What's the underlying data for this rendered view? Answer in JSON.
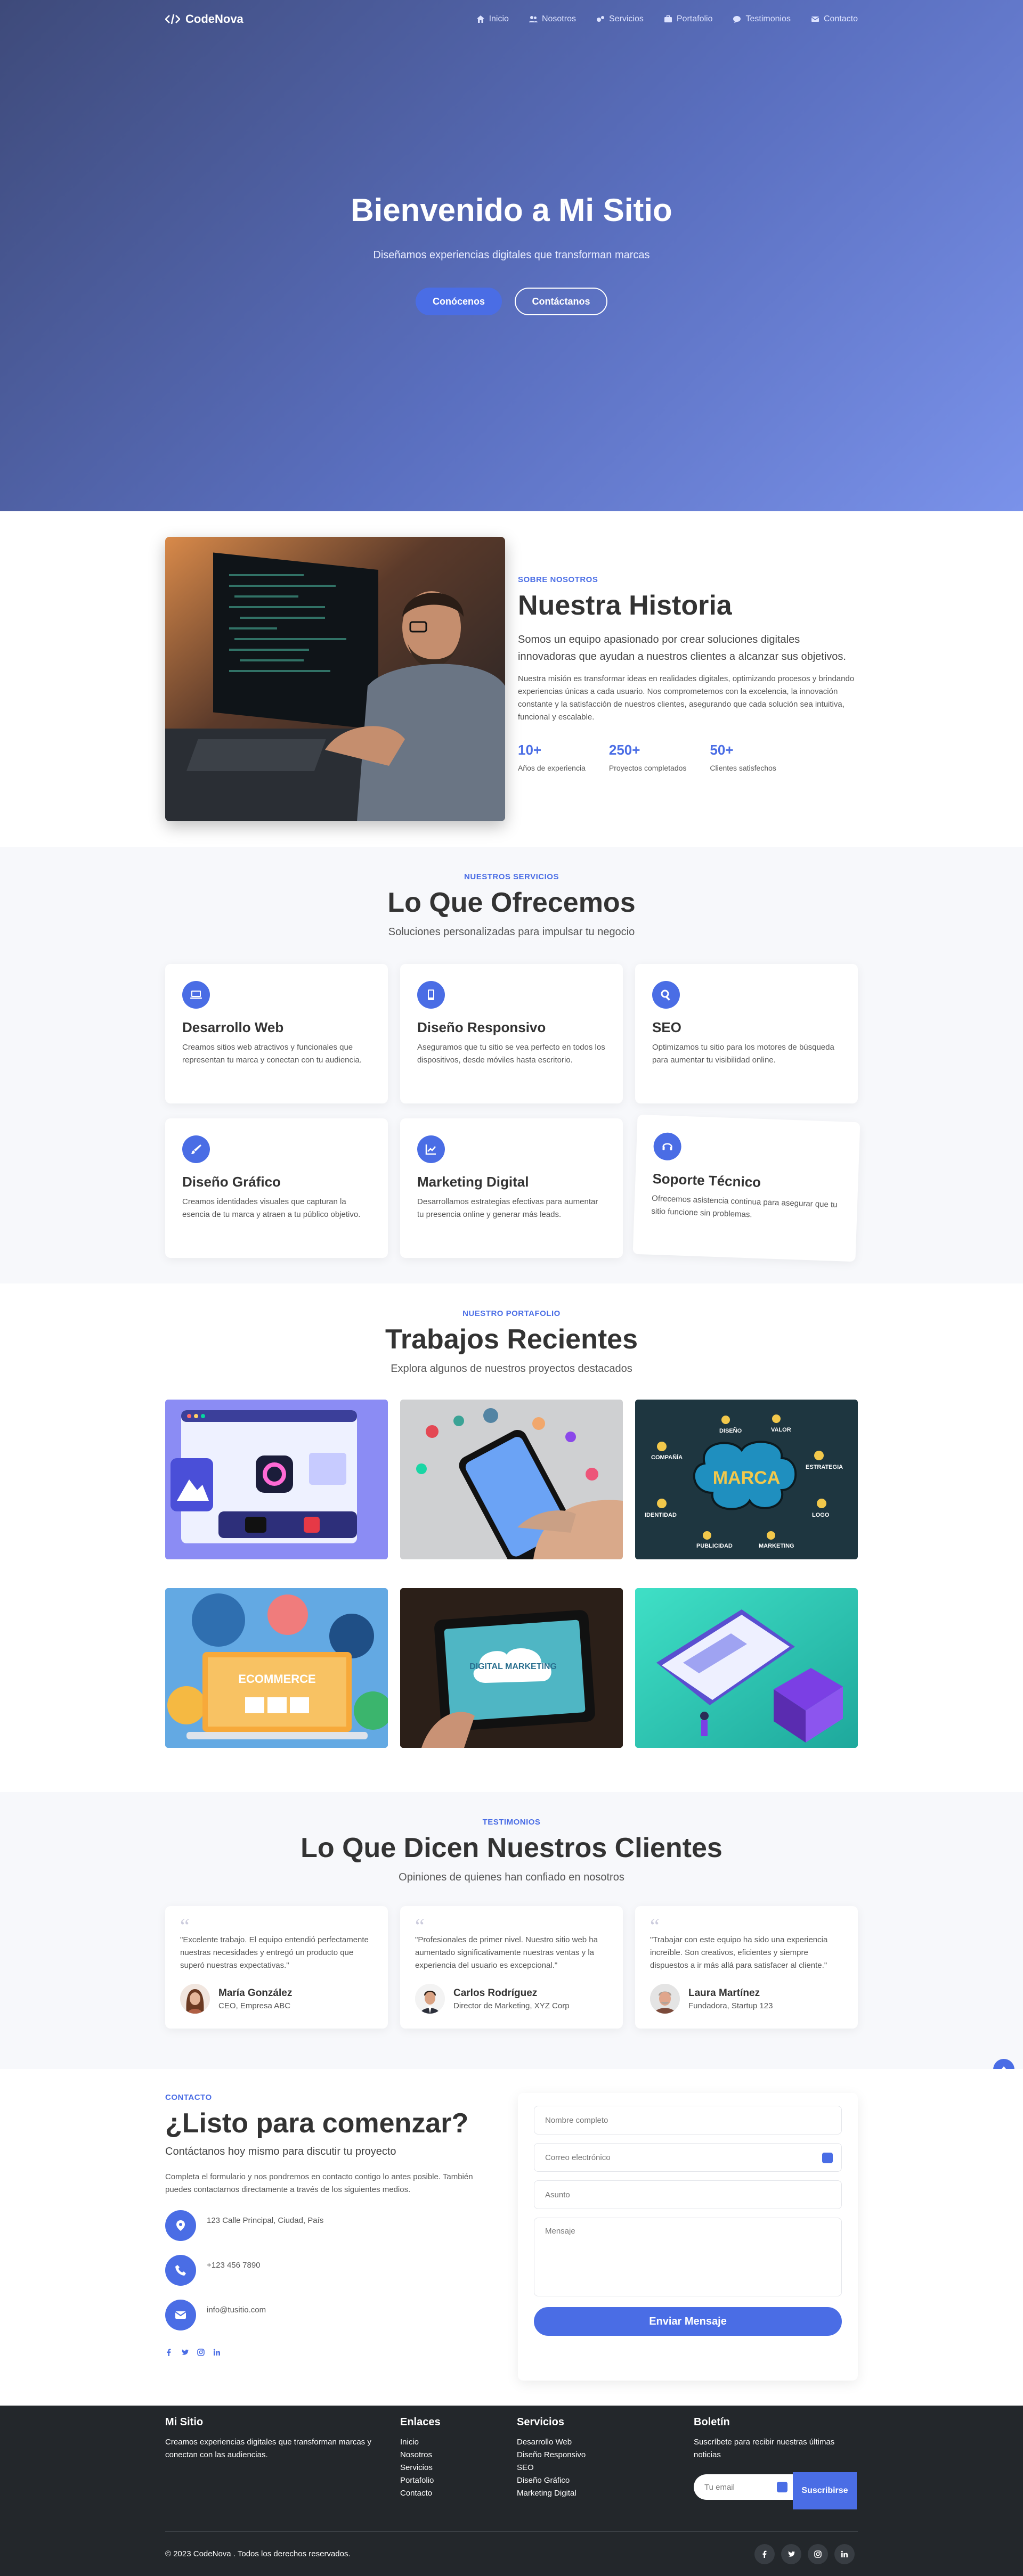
{
  "nav": {
    "logo": "CodeNova",
    "items": [
      "Inicio",
      "Nosotros",
      "Servicios",
      "Portafolio",
      "Testimonios",
      "Contacto"
    ]
  },
  "hero": {
    "title": "Bienvenido a Mi Sitio",
    "subtitle": "Diseñamos experiencias digitales que transforman marcas",
    "primary_btn": "Conócenos",
    "secondary_btn": "Contáctanos"
  },
  "about": {
    "kicker": "SOBRE NOSOTROS",
    "title": "Nuestra Historia",
    "lead": "Somos un equipo apasionado por crear soluciones digitales innovadoras que ayudan a nuestros clientes a alcanzar sus objetivos.",
    "body": "Nuestra misión es transformar ideas en realidades digitales, optimizando procesos y brindando experiencias únicas a cada usuario. Nos comprometemos con la excelencia, la innovación constante y la satisfacción de nuestros clientes, asegurando que cada solución sea intuitiva, funcional y escalable.",
    "stats": [
      {
        "value": "10+",
        "label": "Años de experiencia"
      },
      {
        "value": "250+",
        "label": "Proyectos completados"
      },
      {
        "value": "50+",
        "label": "Clientes satisfechos"
      }
    ]
  },
  "services": {
    "kicker": "NUESTROS SERVICIOS",
    "title": "Lo Que Ofrecemos",
    "subtitle": "Soluciones personalizadas para impulsar tu negocio",
    "cards": [
      {
        "icon": "laptop-icon",
        "title": "Desarrollo Web",
        "desc": "Creamos sitios web atractivos y funcionales que representan tu marca y conectan con tu audiencia."
      },
      {
        "icon": "mobile-icon",
        "title": "Diseño Responsivo",
        "desc": "Aseguramos que tu sitio se vea perfecto en todos los dispositivos, desde móviles hasta escritorio."
      },
      {
        "icon": "search-icon",
        "title": "SEO",
        "desc": "Optimizamos tu sitio para los motores de búsqueda para aumentar tu visibilidad online."
      },
      {
        "icon": "paint-brush-icon",
        "title": "Diseño Gráfico",
        "desc": "Creamos identidades visuales que capturan la esencia de tu marca y atraen a tu público objetivo."
      },
      {
        "icon": "chart-line-icon",
        "title": "Marketing Digital",
        "desc": "Desarrollamos estrategias efectivas para aumentar tu presencia online y generar más leads."
      },
      {
        "icon": "headset-icon",
        "title": "Soporte Técnico",
        "desc": "Ofrecemos asistencia continua para asegurar que tu sitio funcione sin problemas."
      }
    ]
  },
  "portfolio": {
    "kicker": "NUESTRO PORTAFOLIO",
    "title": "Trabajos Recientes",
    "subtitle": "Explora algunos de nuestros proyectos destacados",
    "marca_center": "MARCA",
    "marca_labels": [
      "DISEÑO",
      "VALOR",
      "COMPAÑÍA",
      "ESTRATEGIA",
      "IDENTIDAD",
      "LOGO",
      "PUBLICIDAD",
      "MARKETING"
    ],
    "ecommerce_label": "ECOMMERCE",
    "digital_label": "DIGITAL MARKETING"
  },
  "testimonials": {
    "kicker": "TESTIMONIOS",
    "title": "Lo Que Dicen Nuestros Clientes",
    "subtitle": "Opiniones de quienes han confiado en nosotros",
    "items": [
      {
        "quote": "\"Excelente trabajo. El equipo entendió perfectamente nuestras necesidades y entregó un producto que superó nuestras expectativas.\"",
        "name": "María González",
        "role": "CEO, Empresa ABC"
      },
      {
        "quote": "\"Profesionales de primer nivel. Nuestro sitio web ha aumentado significativamente nuestras ventas y la experiencia del usuario es excepcional.\"",
        "name": "Carlos Rodríguez",
        "role": "Director de Marketing, XYZ Corp"
      },
      {
        "quote": "\"Trabajar con este equipo ha sido una experiencia increíble. Son creativos, eficientes y siempre dispuestos a ir más allá para satisfacer al cliente.\"",
        "name": "Laura Martínez",
        "role": "Fundadora, Startup 123"
      }
    ]
  },
  "contact": {
    "kicker": "CONTACTO",
    "title": "¿Listo para comenzar?",
    "subtitle": "Contáctanos hoy mismo para discutir tu proyecto",
    "body": "Completa el formulario y nos pondremos en contacto contigo lo antes posible. También puedes contactarnos directamente a través de los siguientes medios.",
    "address": "123 Calle Principal, Ciudad, País",
    "phone": "+123 456 7890",
    "email": "info@tusitio.com",
    "form": {
      "name_ph": "Nombre completo",
      "email_ph": "Correo electrónico",
      "subject_ph": "Asunto",
      "message_ph": "Mensaje",
      "submit": "Enviar Mensaje"
    }
  },
  "footer": {
    "brand_title": "Mi Sitio",
    "brand_desc": "Creamos experiencias digitales que transforman marcas y conectan con las audiencias.",
    "links_title": "Enlaces",
    "links": [
      "Inicio",
      "Nosotros",
      "Servicios",
      "Portafolio",
      "Contacto"
    ],
    "services_title": "Servicios",
    "services": [
      "Desarrollo Web",
      "Diseño Responsivo",
      "SEO",
      "Diseño Gráfico",
      "Marketing Digital"
    ],
    "newsletter_title": "Boletín",
    "newsletter_desc": "Suscríbete para recibir nuestras últimas noticias",
    "newsletter_ph": "Tu email",
    "subscribe": "Suscribirse",
    "copyright": "© 2023 CodeNova . Todos los derechos reservados."
  },
  "colors": {
    "accent": "#4a6de5",
    "hero_start": "#3e4a7a",
    "hero_end": "#7a92ea",
    "footer_bg": "#23272b"
  }
}
